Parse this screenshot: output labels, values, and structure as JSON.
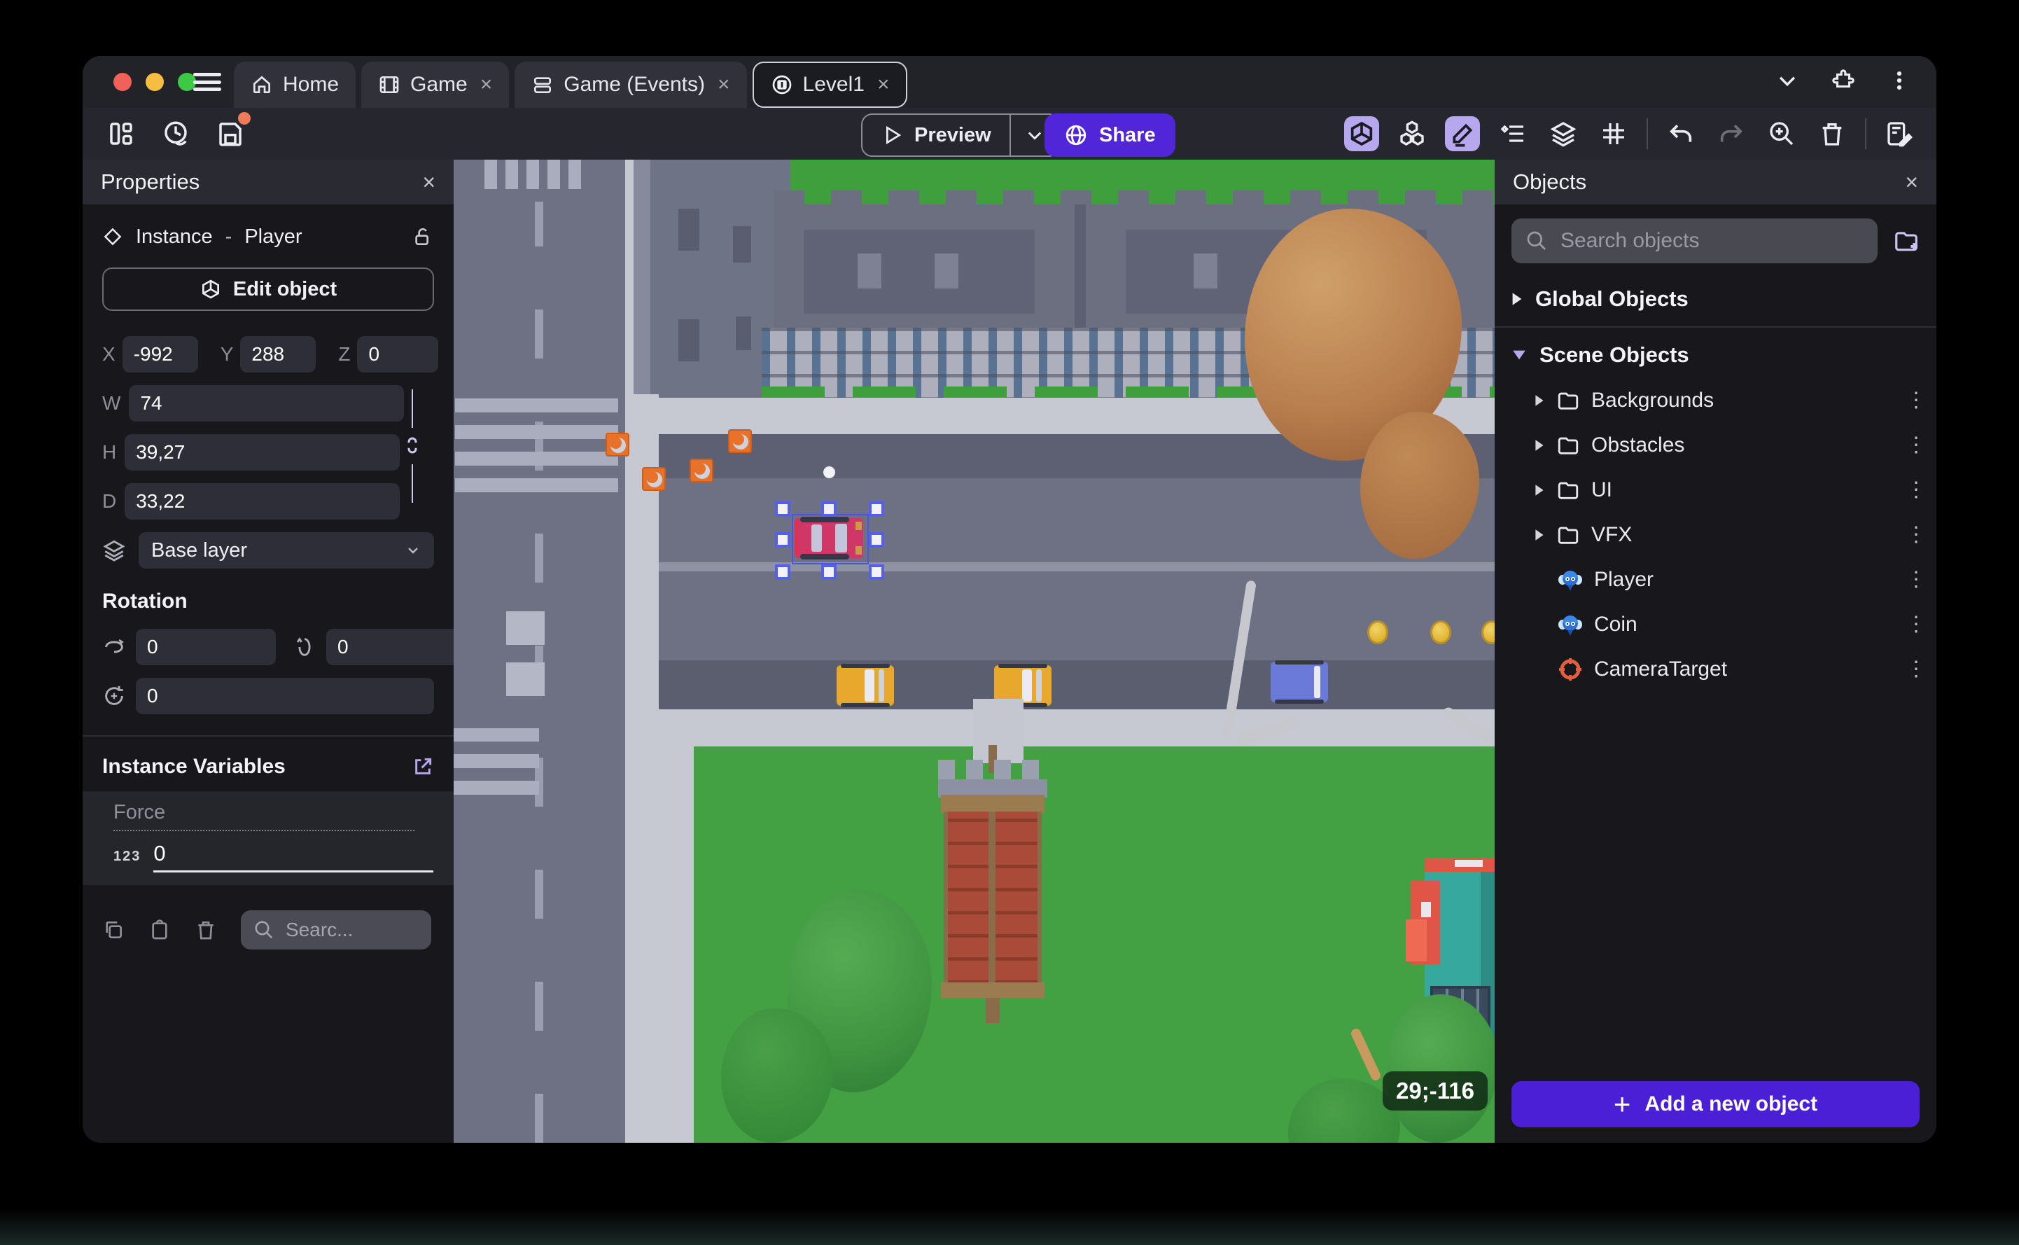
{
  "window": {
    "tabs": [
      {
        "label": "Home"
      },
      {
        "label": "Game"
      },
      {
        "label": "Game (Events)"
      },
      {
        "label": "Level1"
      }
    ],
    "close_symbol": "×"
  },
  "toolbar": {
    "preview_label": "Preview",
    "share_label": "Share"
  },
  "properties_panel": {
    "title": "Properties",
    "instance_label": "Instance",
    "separator": "-",
    "object_name": "Player",
    "edit_object_label": "Edit object",
    "position": {
      "x_label": "X",
      "x": "-992",
      "y_label": "Y",
      "y": "288",
      "z_label": "Z",
      "z": "0"
    },
    "size": {
      "w_label": "W",
      "w": "74",
      "h_label": "H",
      "h": "39,27",
      "d_label": "D",
      "d": "33,22"
    },
    "layer_value": "Base layer",
    "rotation_title": "Rotation",
    "rotation": {
      "x": "0",
      "y": "0",
      "z": "0"
    },
    "variables_title": "Instance Variables",
    "variable": {
      "name": "Force",
      "type_badge": "123",
      "value": "0"
    },
    "search_placeholder": "Searc..."
  },
  "objects_panel": {
    "title": "Objects",
    "search_placeholder": "Search objects",
    "global_group_label": "Global Objects",
    "scene_group_label": "Scene Objects",
    "folders": [
      {
        "name": "Backgrounds"
      },
      {
        "name": "Obstacles"
      },
      {
        "name": "UI"
      },
      {
        "name": "VFX"
      }
    ],
    "objects": [
      {
        "name": "Player"
      },
      {
        "name": "Coin"
      },
      {
        "name": "CameraTarget"
      }
    ],
    "add_button_label": "Add a new object"
  },
  "canvas": {
    "cursor_coordinates": "29;-116"
  },
  "colors": {
    "accent_purple": "#5125d8",
    "add_button_purple": "#4a1fd6",
    "active_tool_bg": "#b7a7ef",
    "selection_blue": "#5560ea",
    "unsaved_dot": "#ee7a57",
    "traffic_red": "#f2605a",
    "traffic_yellow": "#f6be40",
    "traffic_green": "#3ec944"
  }
}
